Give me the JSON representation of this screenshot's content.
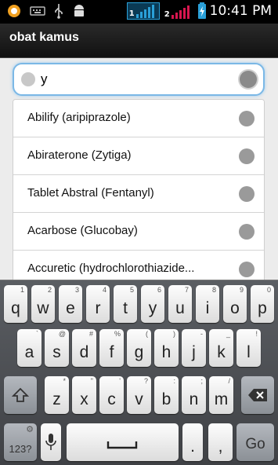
{
  "status": {
    "time": "10:41 PM",
    "sim1": "1",
    "sim2": "2",
    "colors": {
      "sim1": "#2aa0d8",
      "sim2": "#d8164f",
      "battery": "#2aa0d8"
    }
  },
  "app": {
    "title": "obat kamus"
  },
  "search": {
    "value": "y"
  },
  "results": [
    "Abilify (aripiprazole)",
    "Abiraterone (Zytiga)",
    "Tablet Abstral (Fentanyl)",
    "Acarbose (Glucobay)",
    "Accuretic (hydrochlorothiazide..."
  ],
  "keyboard": {
    "row1": [
      {
        "k": "q",
        "s": "1"
      },
      {
        "k": "w",
        "s": "2"
      },
      {
        "k": "e",
        "s": "3"
      },
      {
        "k": "r",
        "s": "4"
      },
      {
        "k": "t",
        "s": "5"
      },
      {
        "k": "y",
        "s": "6"
      },
      {
        "k": "u",
        "s": "7"
      },
      {
        "k": "i",
        "s": "8"
      },
      {
        "k": "o",
        "s": "9"
      },
      {
        "k": "p",
        "s": "0"
      }
    ],
    "row2": [
      {
        "k": "a",
        "s": "`"
      },
      {
        "k": "s",
        "s": "@"
      },
      {
        "k": "d",
        "s": "#"
      },
      {
        "k": "f",
        "s": "%"
      },
      {
        "k": "g",
        "s": "("
      },
      {
        "k": "h",
        "s": ")"
      },
      {
        "k": "j",
        "s": "-"
      },
      {
        "k": "k",
        "s": "_"
      },
      {
        "k": "l",
        "s": "!"
      }
    ],
    "row3": [
      {
        "k": "z",
        "s": "*"
      },
      {
        "k": "x",
        "s": "\""
      },
      {
        "k": "c",
        "s": "'"
      },
      {
        "k": "v",
        "s": "?"
      },
      {
        "k": "b",
        "s": ":"
      },
      {
        "k": "n",
        "s": ";"
      },
      {
        "k": "m",
        "s": "/"
      }
    ],
    "sym_label": "123?",
    "sym_sup": "⚙",
    "period": ".",
    "comma": ",",
    "go_label": "Go"
  }
}
